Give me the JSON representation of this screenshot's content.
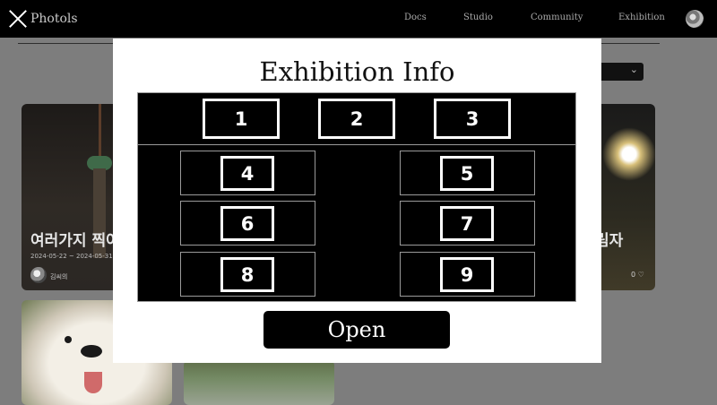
{
  "header": {
    "brand": "Photols",
    "nav": [
      "Docs",
      "Studio",
      "Community",
      "Exhibition"
    ]
  },
  "background": {
    "sort_select_glyph": "⌄",
    "cards": [
      {
        "title": "여러가지 찍어",
        "dates": "2024-05-22 ~ 2024-05-31",
        "author": "김씨의"
      },
      {
        "title": "림자",
        "likes": "0 ♡"
      }
    ]
  },
  "modal": {
    "title": "Exhibition Info",
    "close_icon": "close-icon",
    "top_tiles": [
      "1",
      "2",
      "3"
    ],
    "grid_tiles": [
      "4",
      "5",
      "6",
      "7",
      "8",
      "9"
    ],
    "open_label": "Open"
  },
  "colors": {
    "overlay": "#7d7d7d",
    "modal_bg": "#ffffff",
    "tile_bg": "#000000",
    "tile_border": "#ffffff"
  }
}
